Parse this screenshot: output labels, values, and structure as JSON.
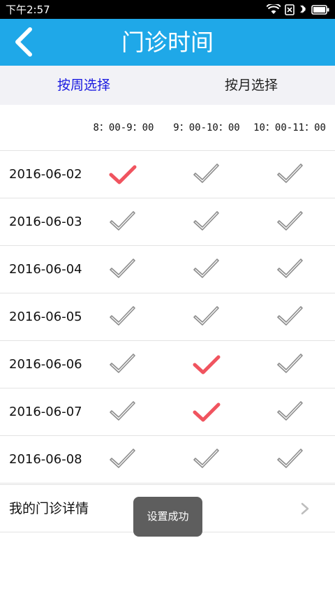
{
  "status_bar": {
    "time": "下午2:57"
  },
  "header": {
    "title": "门诊时间"
  },
  "segment": {
    "tabs": [
      {
        "label": "按周选择",
        "active": true
      },
      {
        "label": "按月选择",
        "active": false
      }
    ]
  },
  "time_slots": [
    "8：00-9：00",
    "9：00-10：00",
    "10：00-11：00"
  ],
  "rows": [
    {
      "date": "2016-06-02",
      "selected": [
        true,
        false,
        false
      ]
    },
    {
      "date": "2016-06-03",
      "selected": [
        false,
        false,
        false
      ]
    },
    {
      "date": "2016-06-04",
      "selected": [
        false,
        false,
        false
      ]
    },
    {
      "date": "2016-06-05",
      "selected": [
        false,
        false,
        false
      ]
    },
    {
      "date": "2016-06-06",
      "selected": [
        false,
        true,
        false
      ]
    },
    {
      "date": "2016-06-07",
      "selected": [
        false,
        true,
        false
      ]
    },
    {
      "date": "2016-06-08",
      "selected": [
        false,
        false,
        false
      ]
    }
  ],
  "details": {
    "label": "我的门诊详情"
  },
  "toast": {
    "message": "设置成功"
  },
  "colors": {
    "header": "#1fa8e8",
    "active_tab": "#1a1ae0",
    "check_selected": "#f0545f",
    "check_unselected": "#8c8c8c"
  }
}
